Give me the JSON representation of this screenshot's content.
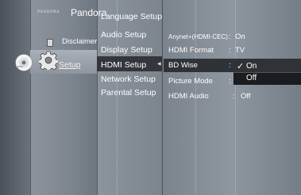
{
  "apps": {
    "pandora_small": "PANDORA",
    "pandora": "Pandora",
    "disclaimer": "Disclaimer",
    "setup": "Setup"
  },
  "menu": {
    "items": [
      {
        "label": "Language Setup"
      },
      {
        "label": "Audio Setup"
      },
      {
        "label": "Display Setup"
      },
      {
        "label": "HDMI Setup"
      },
      {
        "label": "Network Setup"
      },
      {
        "label": "Parental Setup"
      }
    ],
    "selected_arrow": "◀"
  },
  "hdmi": {
    "rows": [
      {
        "label": "Anynet+(HDMI-CEC)",
        "colon": ":",
        "value": "On"
      },
      {
        "label": "HDMI Format",
        "colon": ":",
        "value": "TV"
      },
      {
        "label": "BD Wise",
        "colon": ":",
        "value": ""
      },
      {
        "label": "Picture Mode",
        "colon": ":",
        "value": ""
      },
      {
        "label": "HDMI Audio",
        "colon": ":",
        "value": "Off"
      }
    ]
  },
  "dropdown": {
    "check": "✓",
    "options": [
      "On",
      "Off"
    ]
  },
  "colors": {
    "selected_bg": "#33373d",
    "dropdown_selected_bg": "#2f3338",
    "dropdown_bg": "#1a1c1f"
  }
}
